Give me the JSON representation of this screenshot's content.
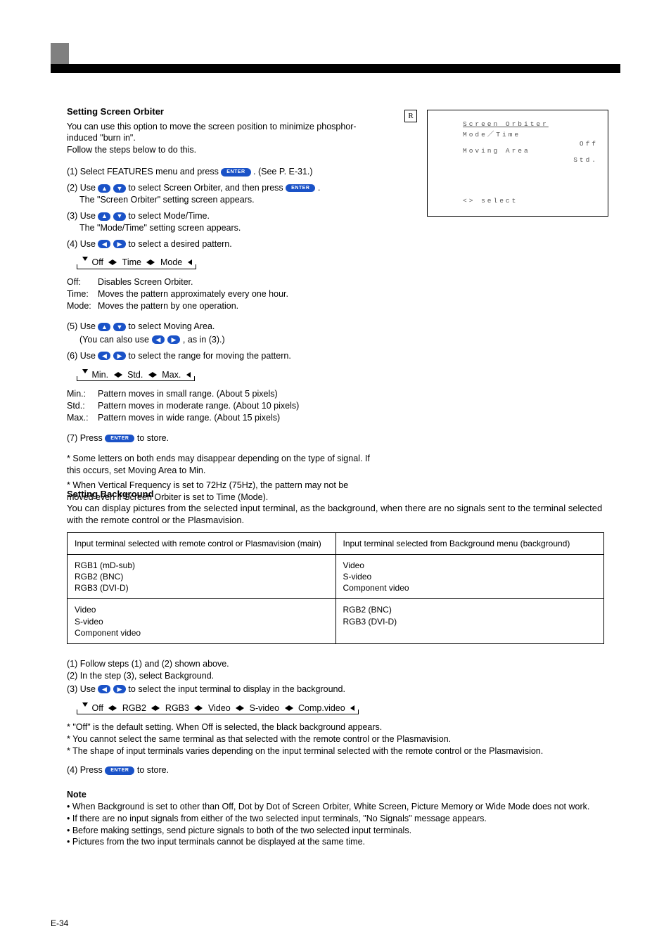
{
  "orbiter": {
    "title": "Setting Screen Orbiter",
    "intro_a": "You can use this option to move the screen position to minimize phosphor-induced \"burn in\".",
    "intro_b": "Follow the steps below to do this.",
    "step1a": "(1) Select FEATURES menu and press ",
    "enter": "ENTER",
    "step1b": ". (See P. E-31.)",
    "step2": "(2) Use ",
    "step2b": " to select Screen Orbiter, and then press",
    "step2c": ".",
    "step2d": "The \"Screen Orbiter\" setting screen appears.",
    "step3a": "(3) Use ",
    "step3b": " to select Mode/Time.",
    "step3c": "The \"Mode/Time\" setting screen appears.",
    "step4a": "(4) Use ",
    "step4b": " to select a desired pattern.",
    "cycle1": [
      "Off",
      "Time",
      "Mode"
    ],
    "mt_off_l": "Off:",
    "mt_off_r": "Disables Screen Orbiter.",
    "mt_time_l": "Time:",
    "mt_time_r": "Moves the pattern approximately every one hour.",
    "mt_mode_l": "Mode:",
    "mt_mode_r": "Moves the pattern by one operation.",
    "step5a": "(5) Use ",
    "step5b": " to select Moving Area.",
    "step5c": ", as in (3).)",
    "step5pre": "(You can also use ",
    "step6a": "(6) Use ",
    "step6b": " to select the range for moving the pattern.",
    "cycle2": [
      "Min.",
      "Std.",
      "Max."
    ],
    "ma_min_l": "Min.:",
    "ma_min_r": "Pattern moves in small range. (About 5 pixels)",
    "ma_std_l": "Std.:",
    "ma_std_r": "Pattern moves in moderate range. (About 10 pixels)",
    "ma_max_l": "Max.:",
    "ma_max_r": "Pattern moves in wide range. (About 15 pixels)",
    "step7a": "(7) Press ",
    "step7b": " to store.",
    "post_note_a": "* Some letters on both ends may disappear depending on the type of signal. If this occurs, set Moving Area to Min.",
    "post_note_b": "* When Vertical Frequency is set to 72Hz (75Hz), the pattern may not be moved even if Screen Orbiter is set to Time (Mode)."
  },
  "osd": {
    "title": "Screen Orbiter",
    "r1l": "Mode／Time",
    "r1r": "Off",
    "r2l": "Moving Area",
    "r2r": "Std.",
    "select": "<> select"
  },
  "bg": {
    "heading": "Setting Background",
    "intro": "You can display pictures from the selected input terminal, as the background, when there are no signals sent to the terminal selected with the remote control or the Plasmavision.",
    "col_main": "Input terminal selected with remote control or Plasmavision (main)",
    "col_bg": "Input terminal selected from Background menu (background)",
    "rows": [
      {
        "l": "RGB1 (mD-sub)",
        "r": "Video"
      },
      {
        "l": "RGB2 (BNC)",
        "r": "S-video"
      },
      {
        "l": "RGB3 (DVI-D)",
        "r": "Component video"
      },
      {
        "l": "Video",
        "r": "RGB2 (BNC)"
      },
      {
        "l": "S-video",
        "r": "RGB3 (DVI-D)"
      },
      {
        "l": "Component video",
        "r": ""
      }
    ],
    "step1a": "(1) Follow steps (1) and (2) shown above.",
    "step1b": "(2) In the step (3), select Background.",
    "step2a": "(3) Use ",
    "step2b": " to select the input terminal to display in the background.",
    "cycle": [
      "Off",
      "RGB2",
      "RGB3",
      "Video",
      "S-video",
      "Comp.video"
    ],
    "note_off": "* \"Off\" is the default setting. When Off is selected, the black background appears.",
    "note_same": "* You cannot select the same terminal as that selected with the remote control or the Plasmavision.",
    "note_shape": "* The shape of input terminals varies depending on the input terminal selected with the remote control or the Plasmavision.",
    "step4a": "(4) Press ",
    "step4b": " to store.",
    "n_head": "Note",
    "n_a": "• When Background is set to other than Off, Dot by Dot of Screen Orbiter, White Screen, Picture Memory or Wide Mode does not work.",
    "n_b": "• If there are no input signals from either of the two selected input terminals, \"No Signals\" message appears.",
    "n_c": "• Before making settings, send picture signals to both of the two selected input terminals.",
    "n_d": "• Pictures from the two input terminals cannot be displayed at the same time."
  },
  "page_no": "E-34",
  "r_label": "R"
}
